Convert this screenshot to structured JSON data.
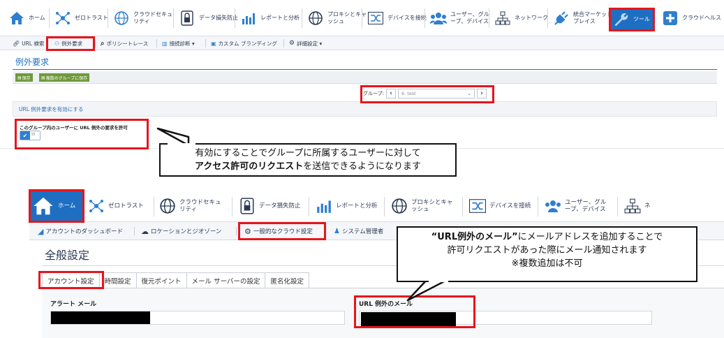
{
  "top": {
    "nav": [
      {
        "label": "ホーム",
        "icon": "home-icon"
      },
      {
        "label": "ゼロトラスト",
        "icon": "network-node-icon"
      },
      {
        "label": "クラウドセキュ\nリティ",
        "icon": "cloud-globe-icon"
      },
      {
        "label": "データ損失防止",
        "icon": "lock-icon"
      },
      {
        "label": "レポートと分析",
        "icon": "chart-icon"
      },
      {
        "label": "プロキシとキャ\nッシュ",
        "icon": "globe-icon"
      },
      {
        "label": "デバイスを接続",
        "icon": "shuffle-icon"
      },
      {
        "label": "ユーザー、グル\nープ、デバイス",
        "icon": "users-icon"
      },
      {
        "label": "ネットワーク",
        "icon": "network-icon"
      },
      {
        "label": "統合マーケット\nプレイス",
        "icon": "plug-icon"
      },
      {
        "label": "ツール",
        "icon": "wrench-icon"
      },
      {
        "label": "クラウドヘルス",
        "icon": "plus-icon"
      }
    ],
    "subnav": [
      {
        "label": "URL 検索",
        "icon": "link-icon"
      },
      {
        "label": "例外要求",
        "icon": "hierarchy-icon"
      },
      {
        "label": "ポリシートレース",
        "icon": "search-icon"
      },
      {
        "label": "接続診断 ▾",
        "icon": "chart-icon"
      },
      {
        "label": "カスタム ブランディング",
        "icon": "image-icon"
      },
      {
        "label": "詳細設定 ▾",
        "icon": "gear-icon"
      }
    ],
    "page_title": "例外要求",
    "save_label": "保存",
    "save_multi_label": "複数のグループに保存",
    "group_label": "グループ:",
    "group_value": "6. test",
    "section_title": "URL 例外要求を有効にする",
    "permission_label": "このグループ内のユーザーに URL 例外の要求を許可",
    "toggle_on": "✔",
    "toggle_off": "III"
  },
  "callout1": {
    "line1": "有効にすることでグループに所属するユーザーに対して",
    "line2_bold": "アクセス許可のリクエスト",
    "line2_rest": "を送信できるようになります"
  },
  "bottom": {
    "nav": [
      {
        "label": "ホーム",
        "icon": "home-icon"
      },
      {
        "label": "ゼロトラスト",
        "icon": "network-node-icon"
      },
      {
        "label": "クラウドセキュ\nリティ",
        "icon": "cloud-globe-icon"
      },
      {
        "label": "データ損失防止",
        "icon": "lock-icon"
      },
      {
        "label": "レポートと分析",
        "icon": "chart-icon"
      },
      {
        "label": "プロキシとキャ\nッシュ",
        "icon": "globe-icon"
      },
      {
        "label": "デバイスを接続",
        "icon": "shuffle-icon"
      },
      {
        "label": "ユーザー、グル\nープ、デバイス",
        "icon": "users-icon"
      },
      {
        "label": "ネ",
        "icon": "network-icon"
      }
    ],
    "subnav": [
      {
        "label": "アカウントのダッシュボード",
        "icon": "chart-icon"
      },
      {
        "label": "ロケーションとジオゾーン",
        "icon": "cloud-pin-icon"
      },
      {
        "label": "一般的なクラウド設定",
        "icon": "gears-icon"
      },
      {
        "label": "システム管理者",
        "icon": "admin-icon"
      }
    ],
    "page_title": "全般設定",
    "tabs": [
      "アカウント設定",
      "時間設定",
      "復元ポイント",
      "メール サーバーの設定",
      "匿名化設定"
    ],
    "alert_mail_label": "アラート メール",
    "url_exception_mail_label": "URL 例外のメール"
  },
  "callout2": {
    "line1_bold": "“URL例外のメール”",
    "line1_rest": "にメールアドレスを追加することで",
    "line2": "許可リクエストがあった際にメール通知されます",
    "line3": "※複数追加は不可"
  },
  "colors": {
    "accent": "#1e6fc2",
    "highlight": "#e8141b",
    "save": "#6f9a3a"
  }
}
